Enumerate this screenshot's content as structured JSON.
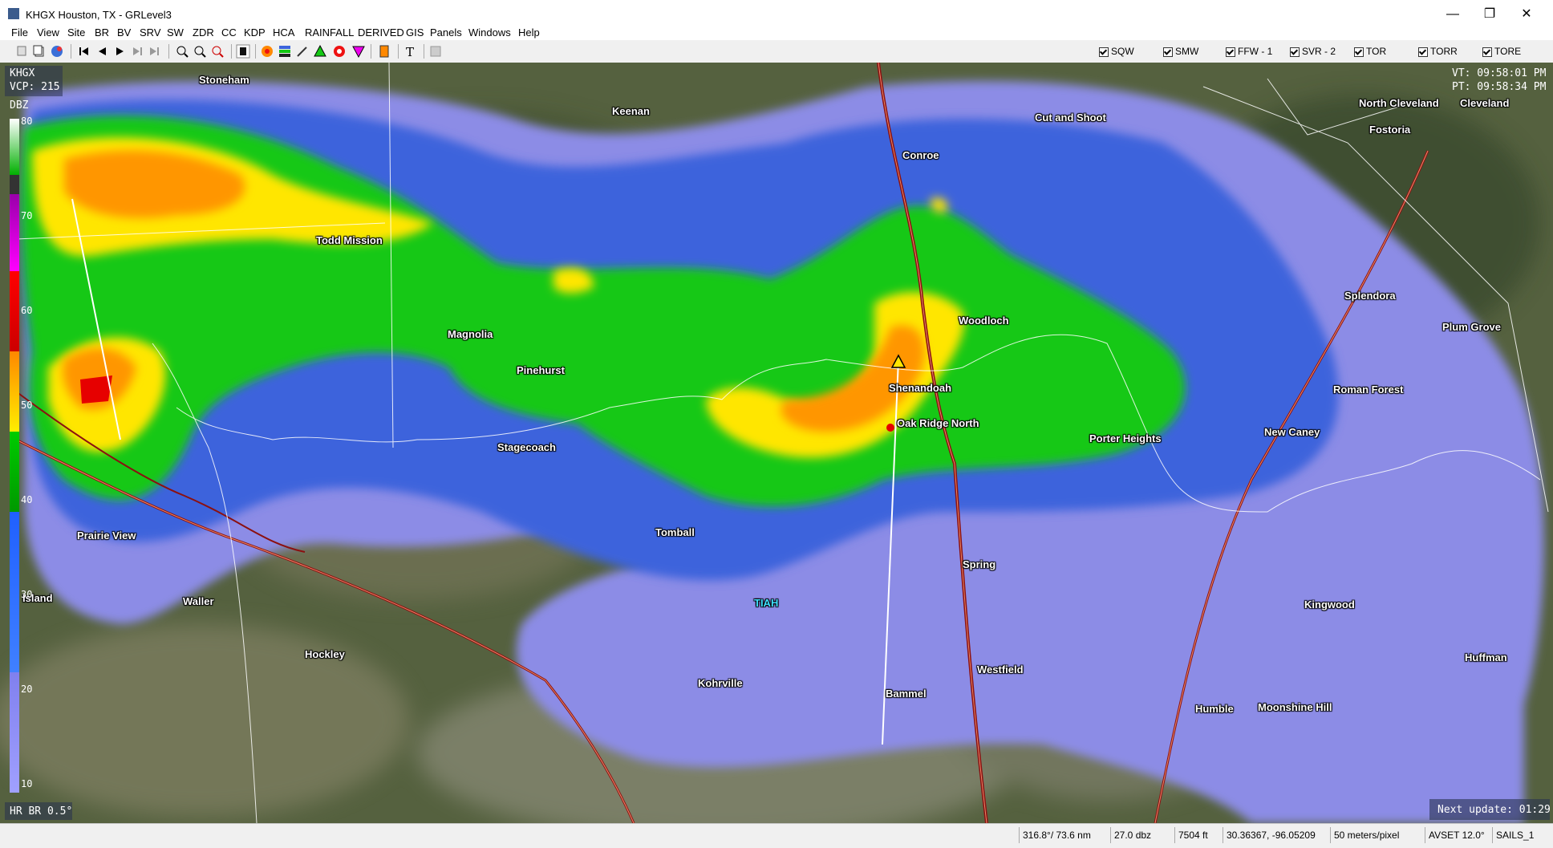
{
  "window": {
    "title": "KHGX Houston, TX - GRLevel3",
    "minimize": "—",
    "maximize": "❐",
    "close": "✕"
  },
  "menu": [
    "File",
    "View",
    "Site",
    "BR",
    "BV",
    "SRV",
    "SW",
    "ZDR",
    "CC",
    "KDP",
    "HCA",
    "RAINFALL",
    "DERIVED",
    "GIS",
    "Panels",
    "Windows",
    "Help"
  ],
  "toolbar": {
    "checkboxes": [
      "SQW",
      "SMW",
      "FFW - 1",
      "SVR - 2",
      "TOR",
      "TORR",
      "TORE"
    ]
  },
  "overlay": {
    "site": "KHGX",
    "vcp": "VCP: 215",
    "units": "DBZ",
    "vt": "VT: 09:58:01 PM",
    "pt": "PT: 09:58:34 PM",
    "product": "HR BR 0.5°",
    "next_update": "Next update: 01:29",
    "legend_ticks": [
      "80",
      "70",
      "60",
      "50",
      "40",
      "30",
      "20",
      "10"
    ]
  },
  "cities": [
    {
      "name": "Stoneham"
    },
    {
      "name": "Keenan"
    },
    {
      "name": "Conroe"
    },
    {
      "name": "Cut and Shoot"
    },
    {
      "name": "North Cleveland"
    },
    {
      "name": "Cleveland"
    },
    {
      "name": "Fostoria"
    },
    {
      "name": "Todd Mission"
    },
    {
      "name": "Splendora"
    },
    {
      "name": "Woodloch"
    },
    {
      "name": "Plum Grove"
    },
    {
      "name": "Magnolia"
    },
    {
      "name": "Pinehurst"
    },
    {
      "name": "Shenandoah"
    },
    {
      "name": "Roman Forest"
    },
    {
      "name": "Oak Ridge North"
    },
    {
      "name": "Porter Heights"
    },
    {
      "name": "New Caney"
    },
    {
      "name": "Stagecoach"
    },
    {
      "name": "Prairie View"
    },
    {
      "name": "Tomball"
    },
    {
      "name": "Spring"
    },
    {
      "name": "Island"
    },
    {
      "name": "Waller"
    },
    {
      "name": "TIAH"
    },
    {
      "name": "Kingwood"
    },
    {
      "name": "Hockley"
    },
    {
      "name": "Huffman"
    },
    {
      "name": "Westfield"
    },
    {
      "name": "Kohrville"
    },
    {
      "name": "Bammel"
    },
    {
      "name": "Humble"
    },
    {
      "name": "Moonshine Hill"
    }
  ],
  "status": {
    "azimuth": "316.8°/ 73.6 nm",
    "value": "27.0 dbz",
    "height": "7504 ft",
    "coords": "30.36367, -96.05209",
    "resolution": "50 meters/pixel",
    "avset": "AVSET 12.0°",
    "sails": "SAILS_1"
  },
  "colors": {
    "satellite": "#55613f",
    "violet": "#8c8ce6",
    "blue": "#3c64dc",
    "green": "#14c814",
    "yellow": "#ffe600",
    "orange": "#ff9600",
    "red": "#e60000"
  }
}
